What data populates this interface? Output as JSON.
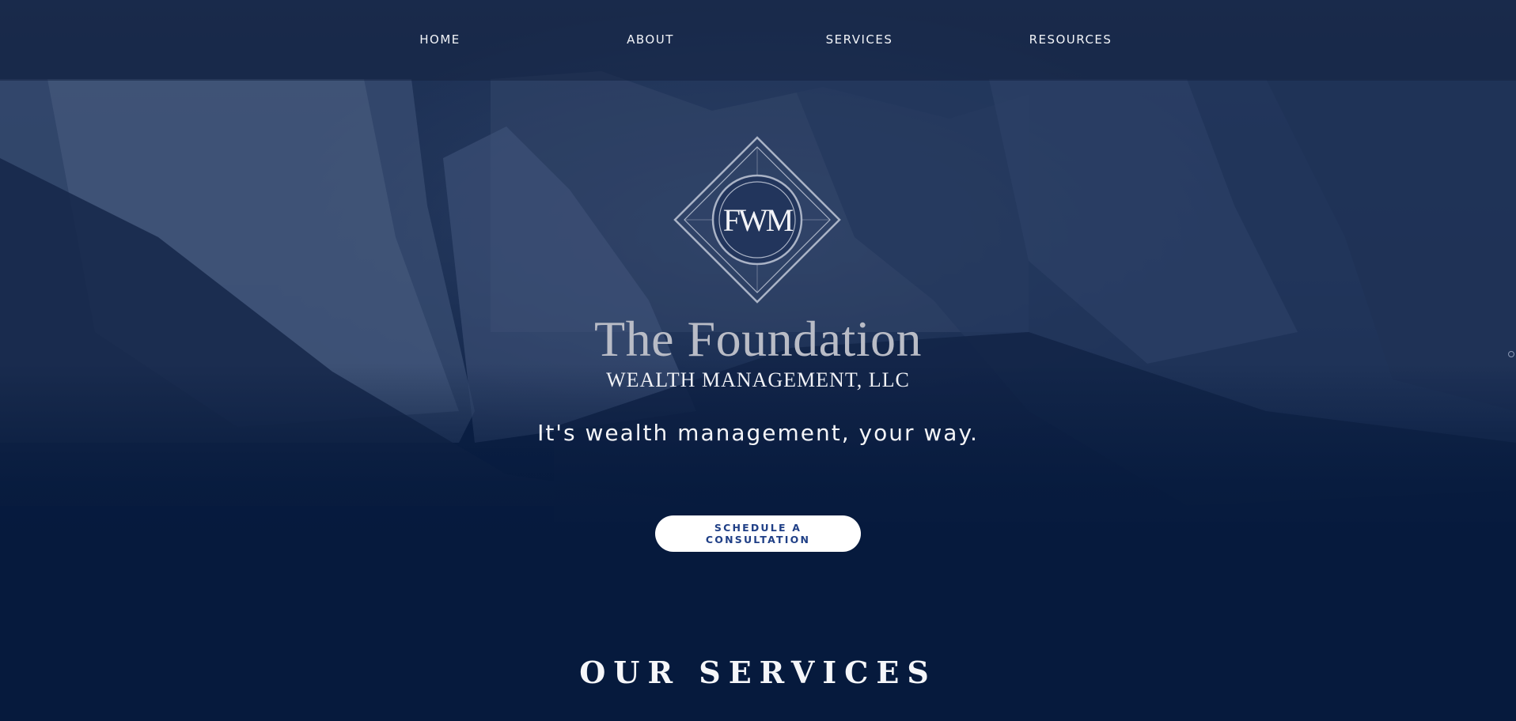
{
  "nav": {
    "items": [
      {
        "label": "HOME"
      },
      {
        "label": "ABOUT"
      },
      {
        "label": "SERVICES"
      },
      {
        "label": "RESOURCES"
      }
    ]
  },
  "logo": {
    "monogram": "FWM"
  },
  "brand": {
    "title": "The Foundation",
    "subtitle": "WEALTH MANAGEMENT, LLC"
  },
  "hero": {
    "tagline": "It's wealth management, your way.",
    "cta_label": "SCHEDULE A CONSULTATION"
  },
  "services": {
    "title": "OUR SERVICES"
  },
  "colors": {
    "background": "#061a3d",
    "cta_text": "#1f3f86",
    "cta_background": "#ffffff",
    "brand_title": "#b9bcc6"
  }
}
